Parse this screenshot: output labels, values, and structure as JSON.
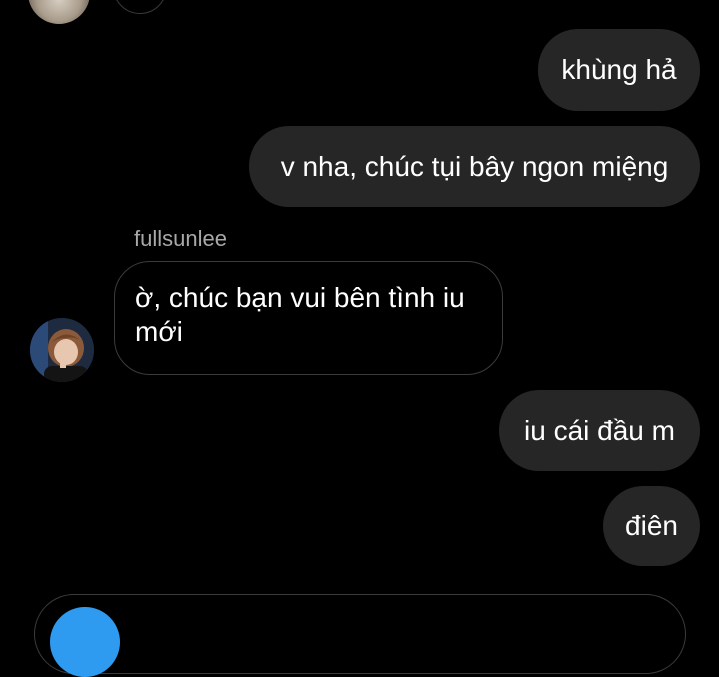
{
  "chat": {
    "messages": [
      {
        "direction": "outgoing",
        "text": "khùng hả"
      },
      {
        "direction": "outgoing",
        "text": "v nha, chúc tụi bây ngon miệng"
      },
      {
        "direction": "incoming",
        "sender": "fullsunlee",
        "text": "ờ, chúc bạn vui bên tình iu mới"
      },
      {
        "direction": "outgoing",
        "text": "iu cái đầu m"
      },
      {
        "direction": "outgoing",
        "text": "điên"
      }
    ]
  },
  "colors": {
    "background": "#000000",
    "outgoing_bubble": "#262626",
    "incoming_border": "#3b3b3b",
    "sender_name": "#a8a8a8",
    "accent": "#2f9bf0"
  }
}
